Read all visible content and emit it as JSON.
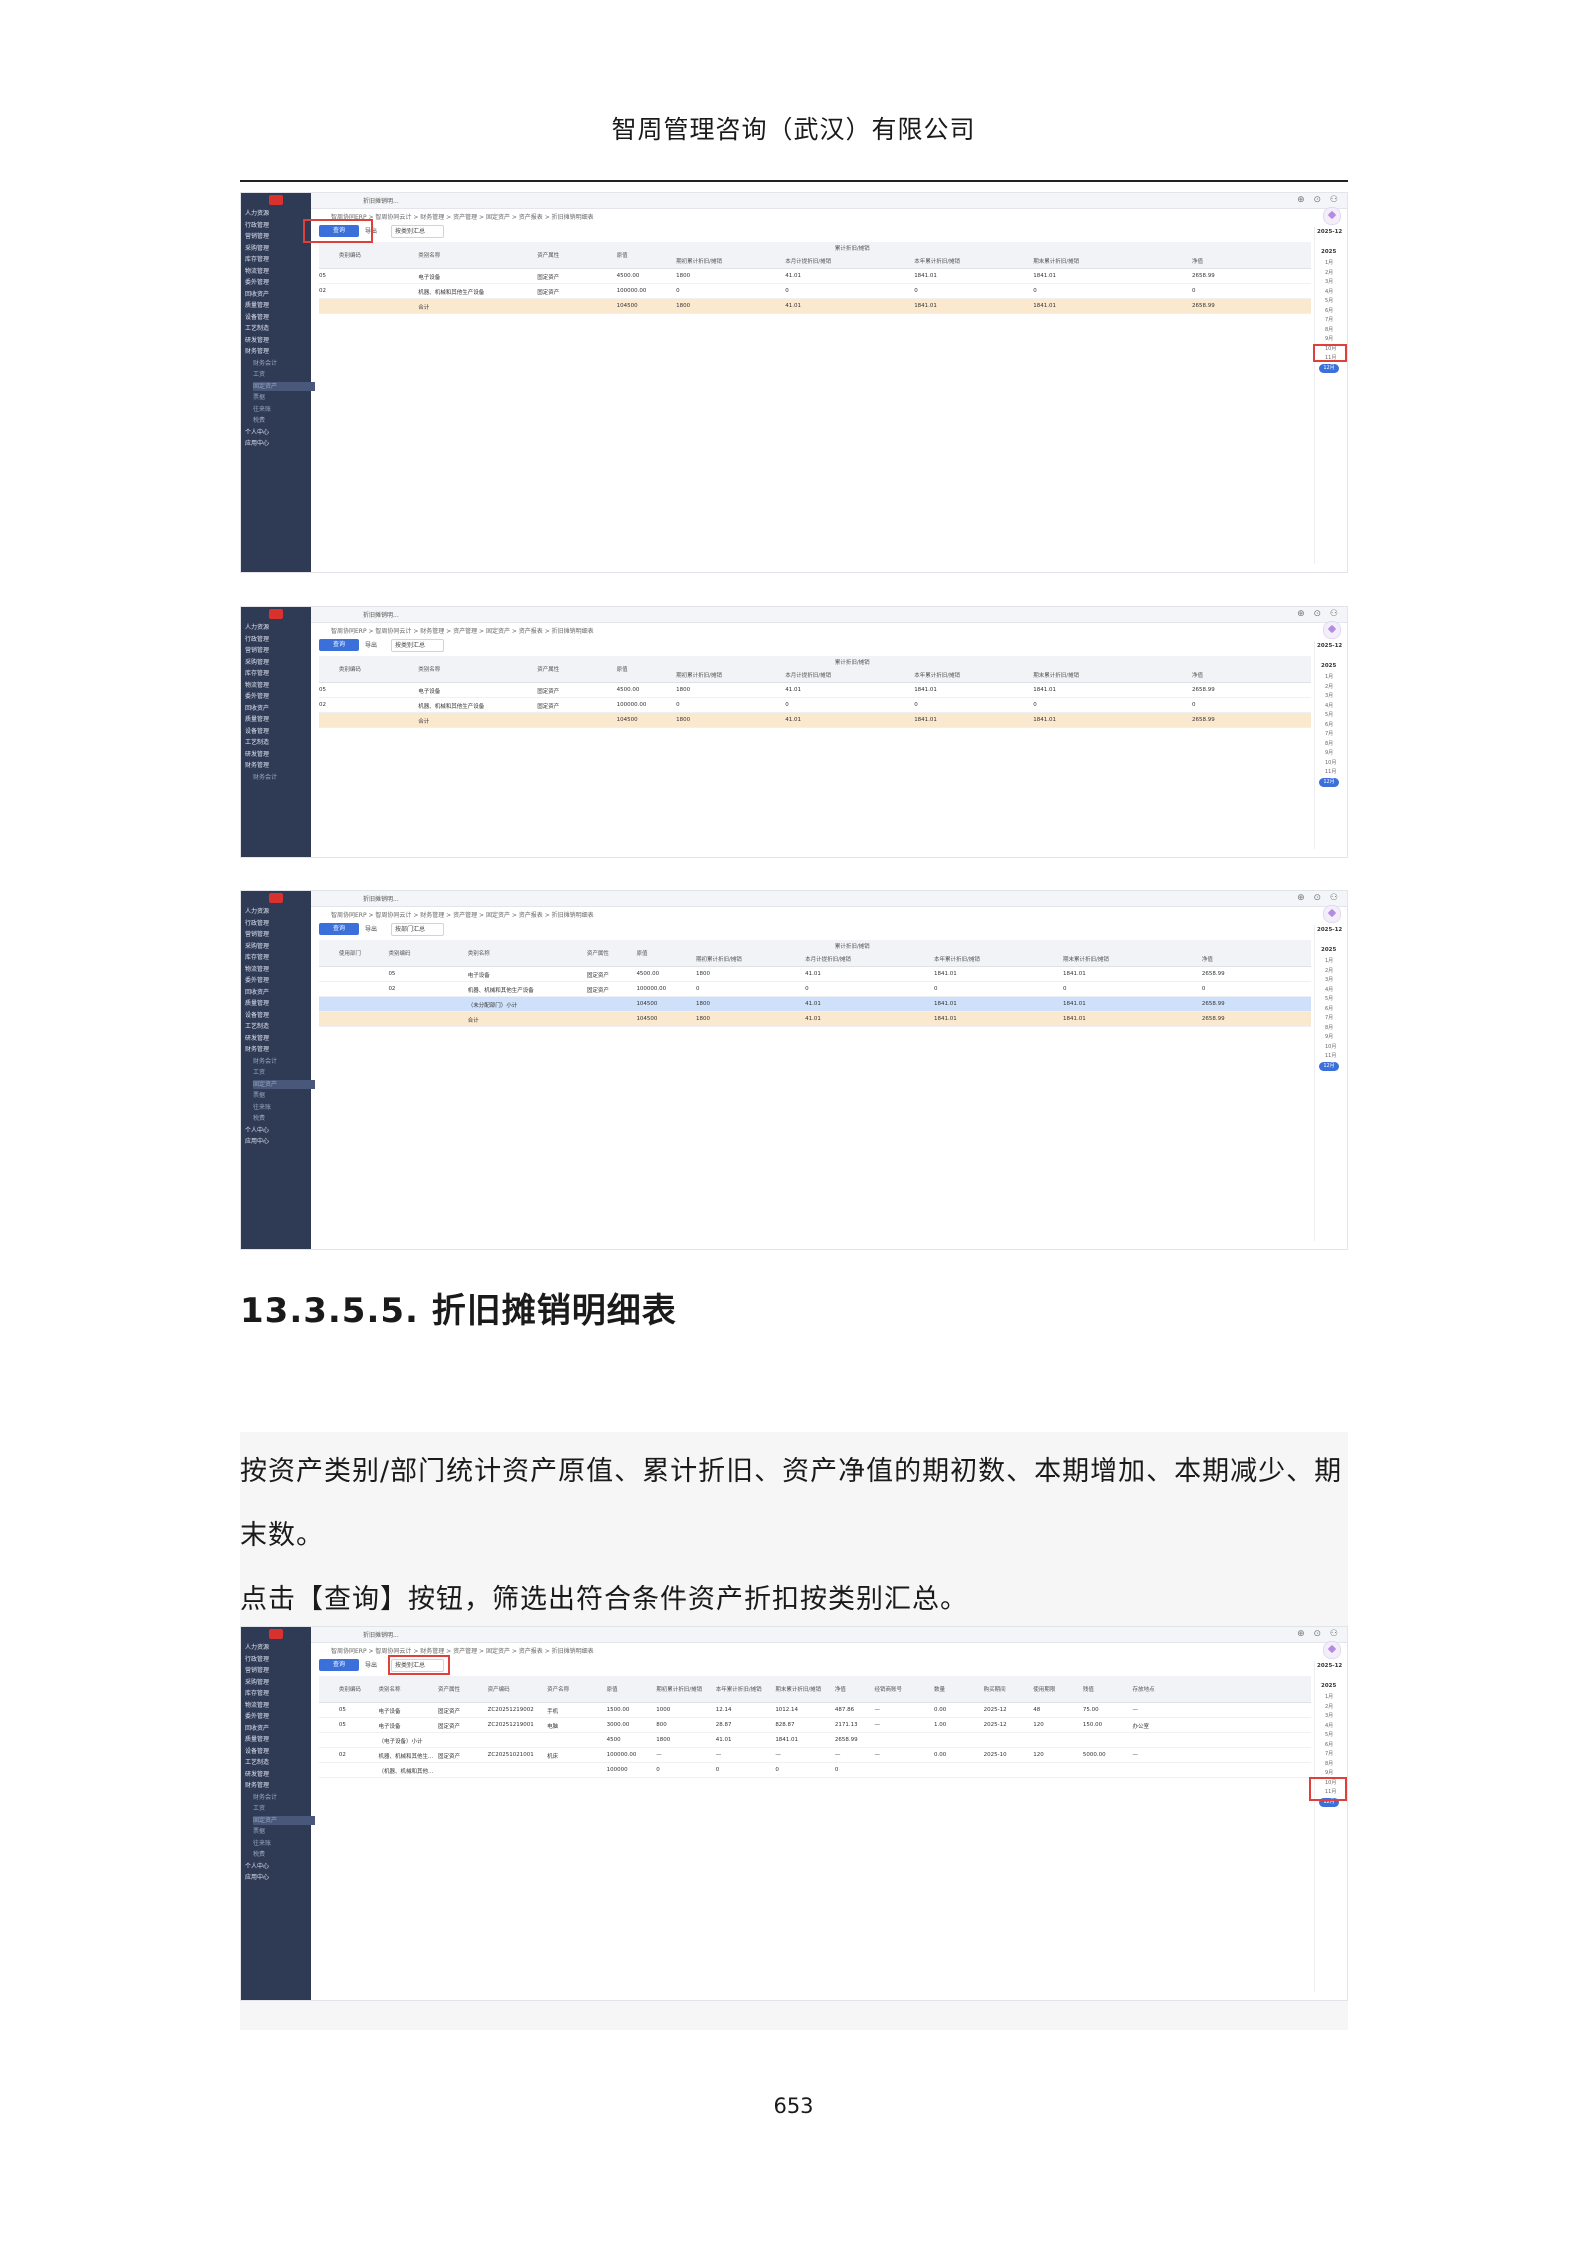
{
  "header": {
    "company": "智周管理咨询（武汉）有限公司"
  },
  "sidebar": {
    "items": [
      "人力资源",
      "行政管理",
      "营销管理",
      "采购管理",
      "库存管理",
      "物流管理",
      "委外管理",
      "回收资产",
      "质量管理",
      "设备管理",
      "工艺制造",
      "研发管理",
      "财务管理"
    ],
    "sub_items": [
      "财务会计",
      "工资",
      "固定资产",
      "票据",
      "往来账",
      "税费"
    ],
    "tail_items": [
      "个人中心",
      "应用中心"
    ]
  },
  "app": {
    "tab": "折旧摊销明...",
    "breadcrumb": "智周协同ERP > 智周协同云计 > 财务管理 > 资产管理 > 固定资产 > 资产报表 > 折旧摊销明细表",
    "query_label": "查询",
    "export_label": "导出",
    "group_select_summary": "按类别汇总",
    "group_select_dept": "按部门汇总"
  },
  "table1": {
    "headers": [
      "类别编码",
      "类别名称",
      "资产属性",
      "原值",
      "累计折旧/摊销",
      "期初累计折旧/摊销",
      "本月计提折旧/摊销",
      "本年累计折旧/摊销",
      "期末累计折旧/摊销",
      "净值"
    ],
    "rows": [
      [
        "05",
        "电子设备",
        "固定资产",
        "4500.00",
        "1800",
        "41.01",
        "1841.01",
        "1841.01",
        "2658.99"
      ],
      [
        "02",
        "机器、机械和其他生产设备",
        "固定资产",
        "100000.00",
        "0",
        "0",
        "0",
        "0",
        "0"
      ]
    ],
    "total": [
      "合计",
      "104500",
      "1800",
      "41.01",
      "1841.01",
      "1841.01",
      "2658.99"
    ]
  },
  "table3": {
    "headers": [
      "使用部门",
      "类别编码",
      "类别名称",
      "资产属性",
      "原值",
      "累计折旧/摊销",
      "期初累计折旧/摊销",
      "本月计提折旧/摊销",
      "本年累计折旧/摊销",
      "期末累计折旧/摊销",
      "净值"
    ],
    "subtotal": [
      "（未分配部门）小计",
      "104500",
      "1800",
      "41.01",
      "1841.01",
      "1841.01",
      "2658.99"
    ]
  },
  "table4": {
    "headers": [
      "类别编码",
      "类别名称",
      "资产属性",
      "资产编码",
      "资产名称",
      "原值",
      "期初累计折旧/摊销",
      "本年累计折旧/摊销",
      "期末累计折旧/摊销",
      "净值",
      "经销商账号",
      "数量",
      "购买期间",
      "使用期限",
      "残值",
      "存放地点"
    ],
    "rows": [
      [
        "05",
        "电子设备",
        "固定资产",
        "ZC20251219002",
        "手机",
        "1500.00",
        "1000",
        "12.14",
        "1012.14",
        "487.86",
        "—",
        "0.00",
        "2025-12",
        "48",
        "75.00",
        "—"
      ],
      [
        "05",
        "电子设备",
        "固定资产",
        "ZC20251219001",
        "电脑",
        "3000.00",
        "800",
        "28.87",
        "828.87",
        "2171.13",
        "—",
        "1.00",
        "2025-12",
        "120",
        "150.00",
        "办公室"
      ],
      [
        "",
        "（电子设备）小计",
        "",
        "",
        "",
        "4500",
        "1800",
        "41.01",
        "1841.01",
        "2658.99",
        "",
        "",
        "",
        "",
        "",
        ""
      ],
      [
        "02",
        "机器、机械和其他生...",
        "固定资产",
        "ZC20251021001",
        "机床",
        "100000.00",
        "—",
        "—",
        "—",
        "—",
        "—",
        "0.00",
        "2025-10",
        "120",
        "5000.00",
        "—"
      ],
      [
        "",
        "（机器、机械和其他...",
        "",
        "",
        "",
        "100000",
        "0",
        "0",
        "0",
        "0",
        "",
        "",
        "",
        "",
        "",
        ""
      ]
    ]
  },
  "period": {
    "current": "2025-12",
    "year": "2025",
    "months": [
      "1月",
      "2月",
      "3月",
      "4月",
      "5月",
      "6月",
      "7月",
      "8月",
      "9月",
      "10月",
      "11月",
      "12月"
    ]
  },
  "section": {
    "title": "13.3.5.5.  折旧摊销明细表"
  },
  "paragraphs": {
    "p1_line1": "按资产类别/部门统计资产原值、累计折旧、资产净值的期初数、本期增加、本期减少、期",
    "p1_line2": "末数。",
    "p2": "点击【查询】按钮，筛选出符合条件资产折扣按类别汇总。"
  },
  "footer": {
    "page_number": "653"
  }
}
